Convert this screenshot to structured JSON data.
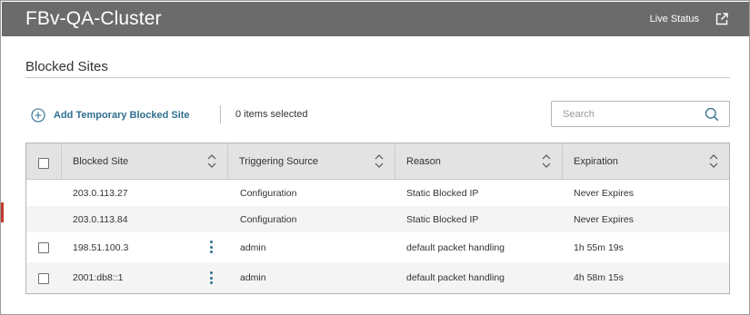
{
  "header": {
    "cluster_name": "FBv-QA-Cluster",
    "live_status_label": "Live Status"
  },
  "page": {
    "section_title": "Blocked Sites"
  },
  "toolbar": {
    "add_label": "Add Temporary Blocked Site",
    "selection_text": "0 items selected"
  },
  "search": {
    "placeholder": "Search",
    "value": ""
  },
  "table": {
    "columns": [
      {
        "label": "Blocked Site"
      },
      {
        "label": "Triggering Source"
      },
      {
        "label": "Reason"
      },
      {
        "label": "Expiration"
      }
    ],
    "rows": [
      {
        "site": "203.0.113.27",
        "source": "Configuration",
        "reason": "Static Blocked IP",
        "expiration": "Never Expires",
        "selectable": false
      },
      {
        "site": "203.0.113.84",
        "source": "Configuration",
        "reason": "Static Blocked IP",
        "expiration": "Never Expires",
        "selectable": false
      },
      {
        "site": "198.51.100.3",
        "source": "admin",
        "reason": "default packet handling",
        "expiration": "1h 55m 19s",
        "selectable": true
      },
      {
        "site": "2001:db8::1",
        "source": "admin",
        "reason": "default packet handling",
        "expiration": "4h 58m 15s",
        "selectable": true
      }
    ]
  },
  "colors": {
    "header_bg": "#6b6b6b",
    "accent": "#2f6f8f",
    "table_header_bg": "#e3e3e3"
  }
}
